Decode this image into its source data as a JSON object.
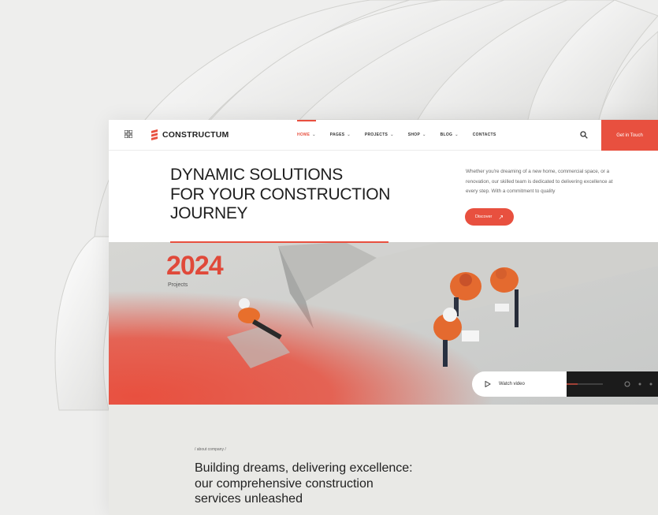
{
  "nav": {
    "logo_text": "CONSTRUCTUM",
    "menu": [
      {
        "label": "HOME",
        "active": true
      },
      {
        "label": "PAGES"
      },
      {
        "label": "PROJECTS"
      },
      {
        "label": "SHOP"
      },
      {
        "label": "BLOG"
      },
      {
        "label": "CONTACTS"
      }
    ],
    "cta_label": "Get in Touch"
  },
  "hero": {
    "title_lines": [
      "DYNAMIC SOLUTIONS",
      "FOR YOUR CONSTRUCTION",
      "JOURNEY"
    ],
    "description": "Whether you're dreaming of a new home, commercial space, or a renovation, our skilled team is dedicated to delivering excellence at every step. With a commitment to quality",
    "discover_label": "Discover",
    "year": "2024",
    "year_label": "Projects",
    "watch_video_label": "Watch video"
  },
  "about": {
    "kicker": "/ about company /",
    "title_lines": [
      "Building dreams, delivering excellence:",
      "our comprehensive construction",
      "services unleashed"
    ]
  },
  "colors": {
    "accent": "#e8503f",
    "dark": "#1b1b1b",
    "text": "#1e1e1e"
  },
  "icons": [
    "grid-icon",
    "logo-mark-icon",
    "chevron-down-icon",
    "search-icon",
    "arrow-up-right-icon",
    "play-icon",
    "settings-icon"
  ]
}
